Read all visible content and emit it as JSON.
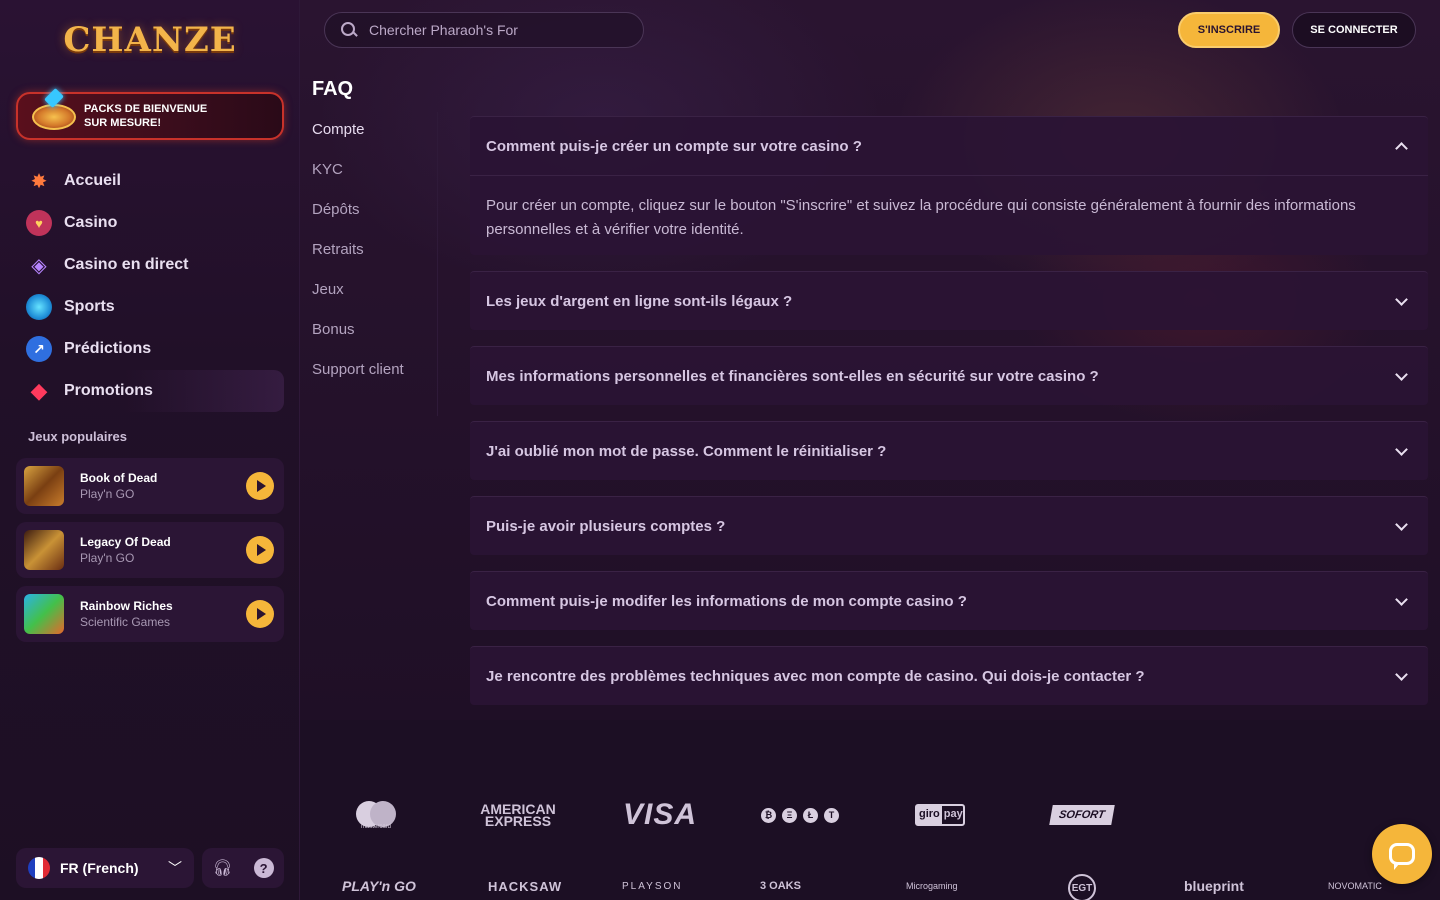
{
  "brand": {
    "logo_text": "CHANZE"
  },
  "welcome_pack": {
    "line1": "PACKS DE BIENVENUE",
    "line2": "SUR MESURE!"
  },
  "nav": [
    {
      "label": "Accueil",
      "icon": "home-star-icon"
    },
    {
      "label": "Casino",
      "icon": "casino-heart-icon"
    },
    {
      "label": "Casino en direct",
      "icon": "live-casino-icon"
    },
    {
      "label": "Sports",
      "icon": "sports-ball-icon"
    },
    {
      "label": "Prédictions",
      "icon": "predictions-chart-icon"
    },
    {
      "label": "Promotions",
      "icon": "promotions-gem-icon"
    }
  ],
  "popular_games": {
    "title": "Jeux populaires",
    "items": [
      {
        "name": "Book of Dead",
        "provider": "Play'n GO"
      },
      {
        "name": "Legacy Of Dead",
        "provider": "Play'n GO"
      },
      {
        "name": "Rainbow Riches",
        "provider": "Scientific Games"
      }
    ]
  },
  "language": {
    "label": "FR (French)"
  },
  "header": {
    "search_placeholder": "Chercher Pharaoh's For",
    "signup_label": "S'INSCRIRE",
    "login_label": "SE CONNECTER"
  },
  "faq": {
    "title": "FAQ",
    "categories": [
      "Compte",
      "KYC",
      "Dépôts",
      "Retraits",
      "Jeux",
      "Bonus",
      "Support client"
    ],
    "items": [
      {
        "question": "Comment puis-je créer un compte sur votre casino ?",
        "answer": "Pour créer un compte, cliquez sur le bouton \"S'inscrire\" et suivez la procédure qui consiste généralement à fournir des informations personnelles et à vérifier votre identité.",
        "expanded": true
      },
      {
        "question": "Les jeux d'argent en ligne sont-ils légaux ?",
        "expanded": false
      },
      {
        "question": "Mes informations personnelles et financières sont-elles en sécurité sur votre casino ?",
        "expanded": false
      },
      {
        "question": "J'ai oublié mon mot de passe. Comment le réinitialiser ?",
        "expanded": false
      },
      {
        "question": "Puis-je avoir plusieurs comptes ?",
        "expanded": false
      },
      {
        "question": "Comment puis-je modifer les informations de mon compte casino ?",
        "expanded": false
      },
      {
        "question": "Je rencontre des problèmes techniques avec mon compte de casino. Qui dois-je contacter ?",
        "expanded": false
      }
    ]
  },
  "payments": {
    "mastercard": "mastercard",
    "amex_line1": "AMERICAN",
    "amex_line2": "EXPRESS",
    "visa": "VISA",
    "crypto": [
      "₿",
      "Ξ",
      "Ł",
      "T"
    ],
    "giropay_1": "giro",
    "giropay_2": "pay",
    "sofort": "SOFORT"
  },
  "providers": [
    "PLAY'n GO",
    "HACKSAW",
    "PLAYSON",
    "3 OAKS",
    "Microgaming",
    "EGT",
    "blueprint",
    "NOVOMATIC"
  ],
  "colors": {
    "accent": "#f5b63a",
    "background": "#1c0f24",
    "sidebar": "#2a1233",
    "card": "#2b1535"
  }
}
